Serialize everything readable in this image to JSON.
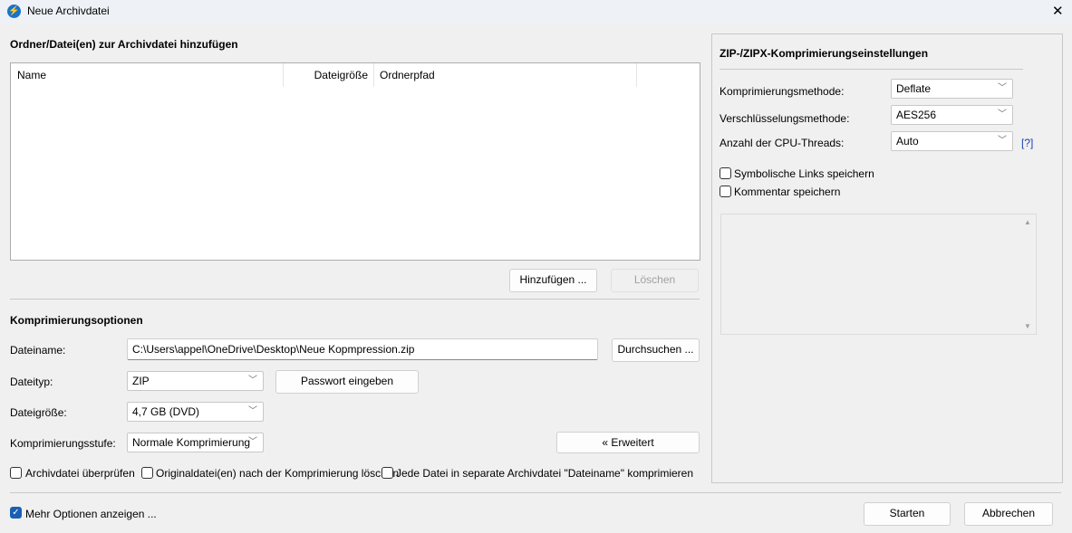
{
  "window": {
    "title": "Neue Archivdatei",
    "close": "✕"
  },
  "files": {
    "heading": "Ordner/Datei(en) zur Archivdatei hinzufügen",
    "columns": [
      "Name",
      "Dateigröße",
      "Ordnerpfad"
    ],
    "add_label": "Hinzufügen ...",
    "delete_label": "Löschen"
  },
  "options": {
    "heading": "Komprimierungsoptionen",
    "filename_label": "Dateiname:",
    "filename_value": "C:\\Users\\appel\\OneDrive\\Desktop\\Neue Kopmpression.zip",
    "browse_label": "Durchsuchen ...",
    "filetype_label": "Dateityp:",
    "filetype_value": "ZIP",
    "password_label": "Passwort eingeben",
    "filesize_label": "Dateigröße:",
    "filesize_value": "4,7 GB (DVD)",
    "level_label": "Komprimierungsstufe:",
    "level_value": "Normale Komprimierung",
    "advanced_label": "« Erweitert",
    "check_verify": "Archivdatei überprüfen",
    "check_delete": "Originaldatei(en) nach der Komprimierung löschen",
    "check_separate": "Jede Datei in separate Archivdatei \"Dateiname\" komprimieren"
  },
  "zip": {
    "heading": "ZIP-/ZIPX-Komprimierungseinstellungen",
    "method_label": "Komprimierungsmethode:",
    "method_value": "Deflate",
    "enc_label": "Verschlüsselungsmethode:",
    "enc_value": "AES256",
    "threads_label": "Anzahl der CPU-Threads:",
    "threads_value": "Auto",
    "help": "[?]",
    "symlinks": "Symbolische Links speichern",
    "comment": "Kommentar speichern"
  },
  "footer": {
    "more_options": "Mehr Optionen anzeigen ...",
    "start": "Starten",
    "cancel": "Abbrechen"
  }
}
